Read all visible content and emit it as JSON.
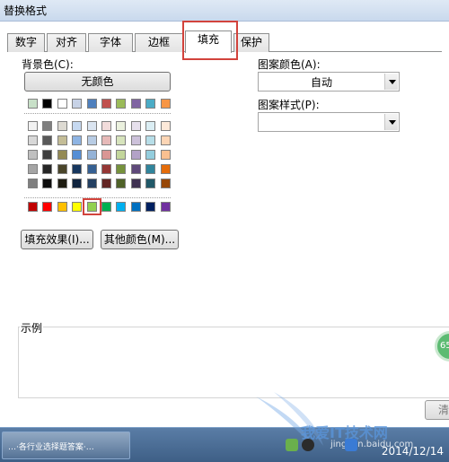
{
  "window": {
    "title": "替换格式"
  },
  "tabs": [
    {
      "label": "数字",
      "active": false
    },
    {
      "label": "对齐",
      "active": false
    },
    {
      "label": "字体",
      "active": false
    },
    {
      "label": "边框",
      "active": false
    },
    {
      "label": "填充",
      "active": true
    },
    {
      "label": "保护",
      "active": false
    }
  ],
  "fill": {
    "background_label": "背景色(C):",
    "no_color_button": "无颜色",
    "palette_top": [
      "#c8e0c8",
      "#000000",
      "#ffffff",
      "#c7d2e6",
      "#4f80bd",
      "#c0504d",
      "#9bbb59",
      "#8064a2",
      "#4bacc6",
      "#f79646"
    ],
    "palette_theme": [
      [
        "#f2f2f2",
        "#7f7f7f",
        "#dddad2",
        "#c6d9f1",
        "#dbe5f1",
        "#f2dcdb",
        "#ebf1de",
        "#e6e0ec",
        "#dbeef4",
        "#fde9d9"
      ],
      [
        "#d8d8d8",
        "#595959",
        "#c4bd97",
        "#8eb4e3",
        "#b8cce4",
        "#e6b9b8",
        "#d7e4bd",
        "#ccc1da",
        "#b7dee8",
        "#fcd5b5"
      ],
      [
        "#bfbfbf",
        "#3f3f3f",
        "#948a54",
        "#558ed5",
        "#95b3d7",
        "#d99694",
        "#c3d69b",
        "#b3a2c7",
        "#93cddd",
        "#fac090"
      ],
      [
        "#a5a5a5",
        "#262626",
        "#4a452a",
        "#17375e",
        "#366092",
        "#953735",
        "#76923c",
        "#5f497a",
        "#31859c",
        "#e46c0a"
      ],
      [
        "#7f7f7f",
        "#0d0d0d",
        "#1e1c11",
        "#10243f",
        "#244062",
        "#632523",
        "#4f6228",
        "#3f3151",
        "#215968",
        "#984807"
      ]
    ],
    "palette_standard": [
      "#c00000",
      "#ff0000",
      "#ffc000",
      "#ffff00",
      "#92d050",
      "#00b050",
      "#00b0f0",
      "#0070c0",
      "#002060",
      "#7030a0"
    ],
    "selected_standard_index": 4,
    "fill_effects_button": "填充效果(I)...",
    "more_colors_button": "其他颜色(M)...",
    "pattern_color_label": "图案颜色(A):",
    "pattern_color_value": "自动",
    "pattern_style_label": "图案样式(P):",
    "pattern_style_value": "",
    "sample_label": "示例",
    "ok_label": "清"
  },
  "overlay": {
    "badge": "65"
  },
  "taskbar": {
    "task_label": "…·各行业选择题答案·…",
    "clock_date": "2014/12/14",
    "watermark_main": "我爱IT技术网",
    "watermark_sub": "jingyan.baidu.com"
  },
  "colors": {
    "highlight": "#d2433c",
    "taskbar": "#4a6d96"
  }
}
